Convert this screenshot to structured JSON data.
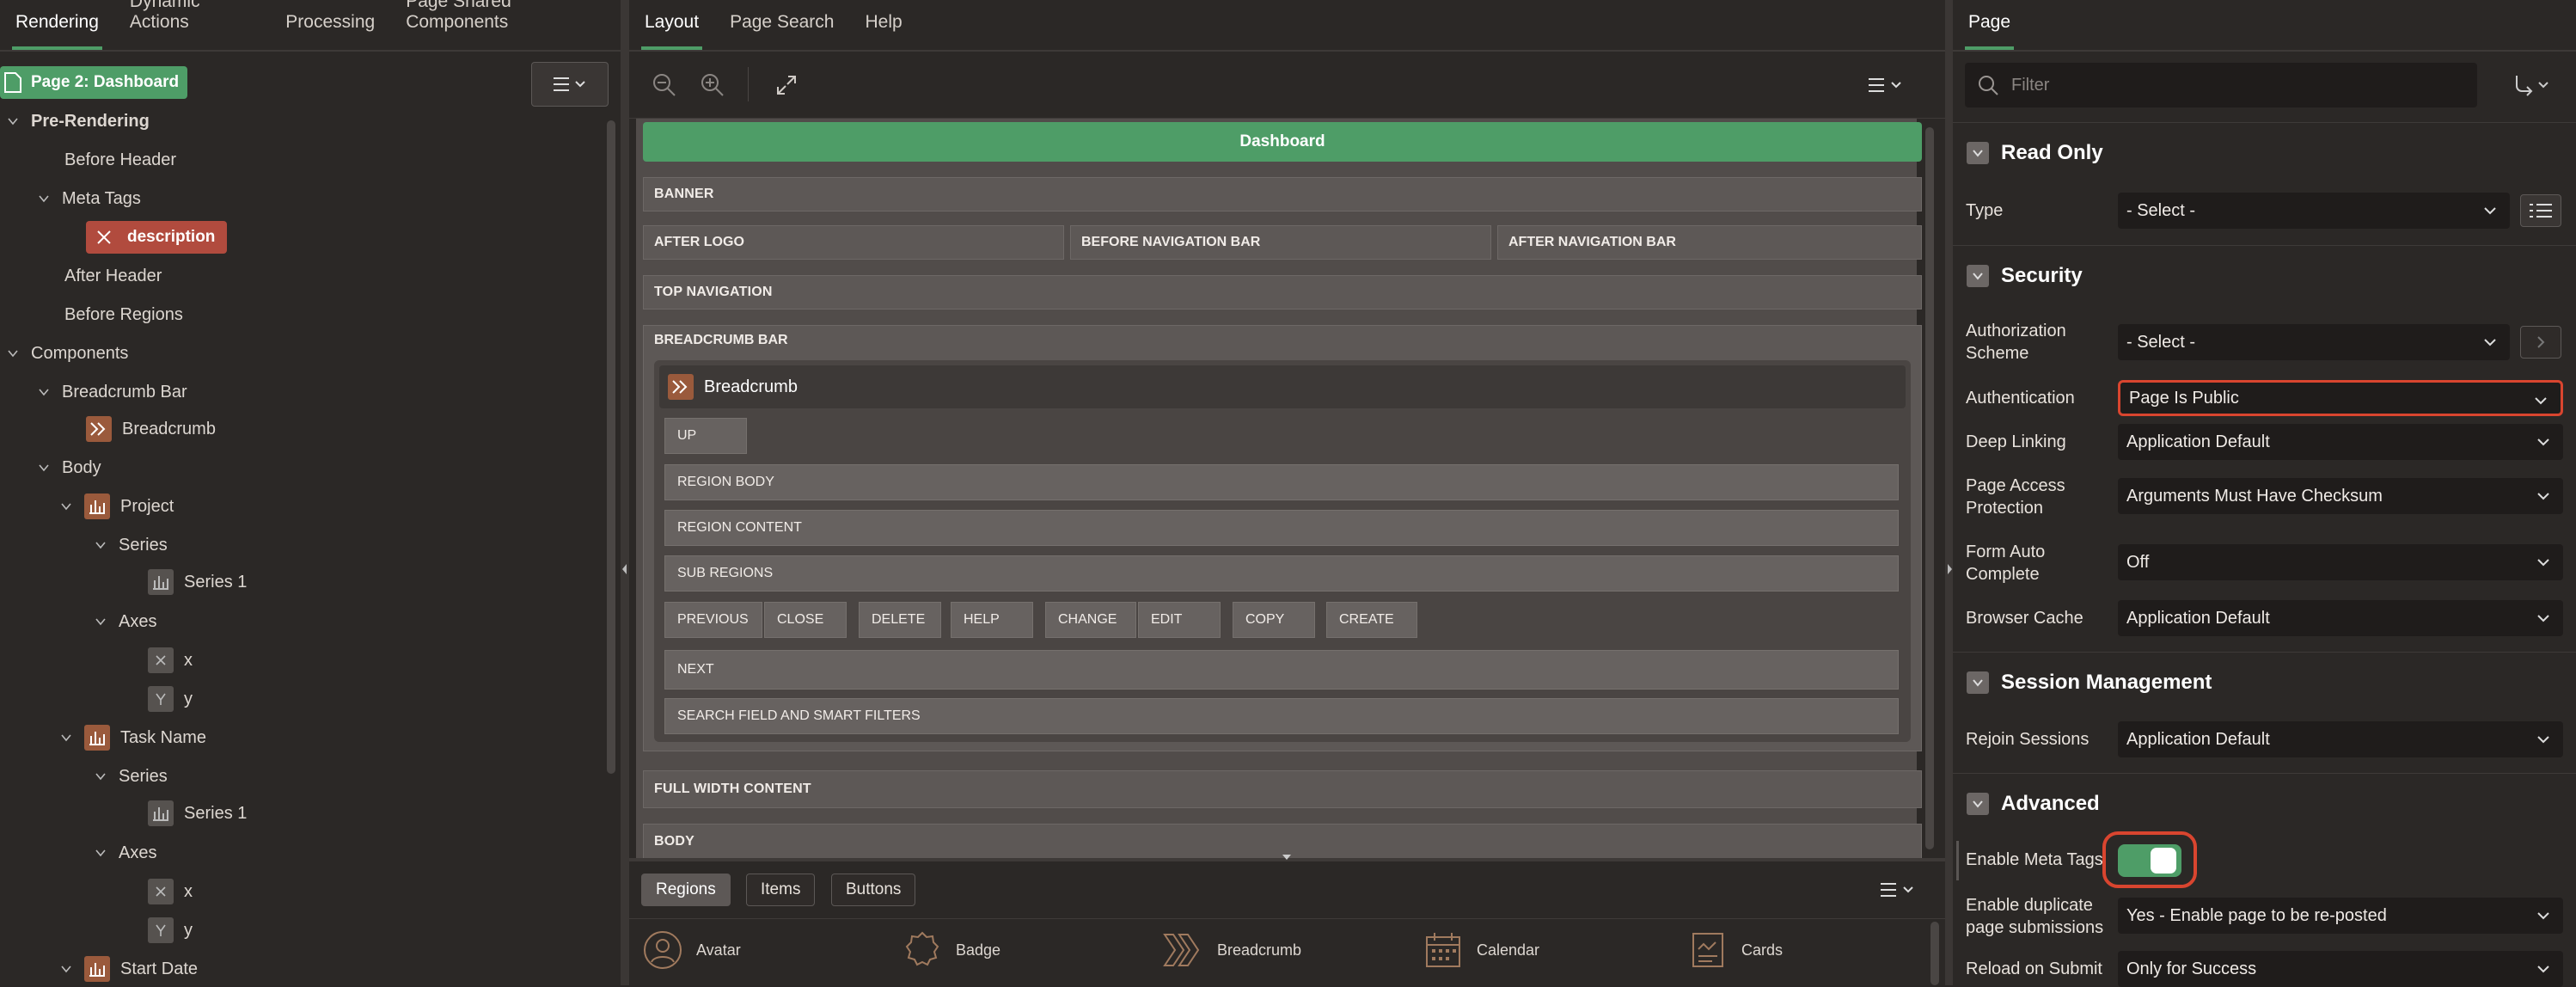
{
  "left_panel": {
    "tabs": [
      "Rendering",
      "Dynamic Actions",
      "Processing",
      "Page Shared Components"
    ],
    "active_tab": "Rendering",
    "page_badge": "Page 2: Dashboard",
    "tree": {
      "pre_rendering": "Pre-Rendering",
      "before_header": "Before Header",
      "meta_tags": "Meta Tags",
      "description": "description",
      "after_header": "After Header",
      "before_regions": "Before Regions",
      "components": "Components",
      "breadcrumb_bar": "Breadcrumb Bar",
      "breadcrumb": "Breadcrumb",
      "body": "Body",
      "project": "Project",
      "series_1": "Series",
      "series_1_item": "Series 1",
      "axes_1": "Axes",
      "x_1": "x",
      "y_1": "y",
      "task_name": "Task Name",
      "series_2": "Series",
      "series_2_item": "Series 1",
      "axes_2": "Axes",
      "x_2": "x",
      "y_2": "y",
      "start_date": "Start Date"
    }
  },
  "middle_panel": {
    "tabs": [
      "Layout",
      "Page Search",
      "Help"
    ],
    "active_tab": "Layout",
    "dashboard_title": "Dashboard",
    "layout": {
      "banner": "BANNER",
      "after_logo": "AFTER LOGO",
      "before_nav": "BEFORE NAVIGATION BAR",
      "after_nav": "AFTER NAVIGATION BAR",
      "top_nav": "TOP NAVIGATION",
      "breadcrumb_bar": "BREADCRUMB BAR",
      "breadcrumb_region": "Breadcrumb",
      "up": "UP",
      "region_body": "REGION BODY",
      "region_content": "REGION CONTENT",
      "sub_regions": "SUB REGIONS",
      "buttons": [
        "PREVIOUS",
        "CLOSE",
        "DELETE",
        "HELP",
        "CHANGE",
        "EDIT",
        "COPY",
        "CREATE"
      ],
      "next": "NEXT",
      "search_field": "SEARCH FIELD AND SMART FILTERS",
      "full_width": "FULL WIDTH CONTENT",
      "body": "BODY"
    },
    "gallery_tabs": [
      "Regions",
      "Items",
      "Buttons"
    ],
    "gallery_active": "Regions",
    "gallery_items": [
      "Avatar",
      "Badge",
      "Breadcrumb",
      "Calendar",
      "Cards"
    ]
  },
  "right_panel": {
    "tab": "Page",
    "filter_placeholder": "Filter",
    "sections": {
      "read_only": "Read Only",
      "security": "Security",
      "session_management": "Session Management",
      "advanced": "Advanced"
    },
    "props": {
      "type_label": "Type",
      "type_value": "- Select -",
      "auth_scheme_label": "Authorization Scheme",
      "auth_scheme_value": "- Select -",
      "authentication_label": "Authentication",
      "authentication_value": "Page Is Public",
      "deep_linking_label": "Deep Linking",
      "deep_linking_value": "Application Default",
      "page_access_label": "Page Access Protection",
      "page_access_value": "Arguments Must Have Checksum",
      "form_auto_label": "Form Auto Complete",
      "form_auto_value": "Off",
      "browser_cache_label": "Browser Cache",
      "browser_cache_value": "Application Default",
      "rejoin_label": "Rejoin Sessions",
      "rejoin_value": "Application Default",
      "meta_tags_label": "Enable Meta Tags",
      "meta_tags_enabled": true,
      "duplicate_label": "Enable duplicate page submissions",
      "duplicate_value": "Yes - Enable page to be re-posted",
      "reload_label": "Reload on Submit",
      "reload_value": "Only for Success"
    },
    "colors": {
      "accent_green": "#4e9d67",
      "highlight_red": "#d9452f"
    }
  }
}
